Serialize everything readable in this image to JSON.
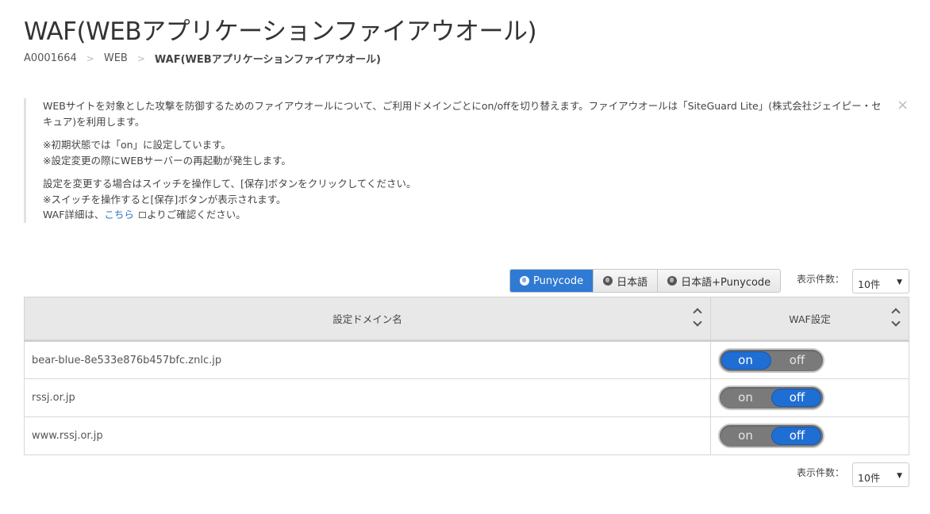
{
  "title": "WAF(WEBアプリケーションファイアウオール)",
  "breadcrumb": {
    "items": [
      "A0001664",
      "WEB"
    ],
    "current": "WAF(WEBアプリケーションファイアウオール)"
  },
  "notice": {
    "p1": "WEBサイトを対象とした攻撃を防御するためのファイアウオールについて、ご利用ドメインごとにon/offを切り替えます。ファイアウオールは「SiteGuard Lite」(株式会社ジェイピー・セキュア)を利用します。",
    "p2a": "※初期状態では「on」に設定しています。",
    "p2b": "※設定変更の際にWEBサーバーの再起動が発生します。",
    "p3a": "設定を変更する場合はスイッチを操作して、[保存]ボタンをクリックしてください。",
    "p3b": "※スイッチを操作すると[保存]ボタンが表示されます。",
    "p3c_prefix": "WAF詳細は、",
    "p3c_link": "こちら",
    "p3c_suffix": "よりご確認ください。",
    "close": "×"
  },
  "display_mode": {
    "options": [
      "Punycode",
      "日本語",
      "日本語+Punycode"
    ],
    "selected": "Punycode"
  },
  "per_page": {
    "label": "表示件数：",
    "value": "10件"
  },
  "table": {
    "headers": {
      "domain": "設定ドメイン名",
      "waf": "WAF設定"
    },
    "rows": [
      {
        "domain": "bear-blue-8e533e876b457bfc.znlc.jp",
        "waf": "on"
      },
      {
        "domain": "rssj.or.jp",
        "waf": "off"
      },
      {
        "domain": "www.rssj.or.jp",
        "waf": "off"
      }
    ]
  },
  "toggle_labels": {
    "on": "on",
    "off": "off"
  },
  "colors": {
    "accent": "#2f7ad2",
    "switch_knob": "#1f6ed4",
    "switch_track": "#7a7a7a",
    "link": "#2a76c6"
  },
  "icons": {
    "mode_buttons": "globe-icon",
    "link": "external-window-icon",
    "sort": "sort-icon",
    "close": "close-icon"
  }
}
